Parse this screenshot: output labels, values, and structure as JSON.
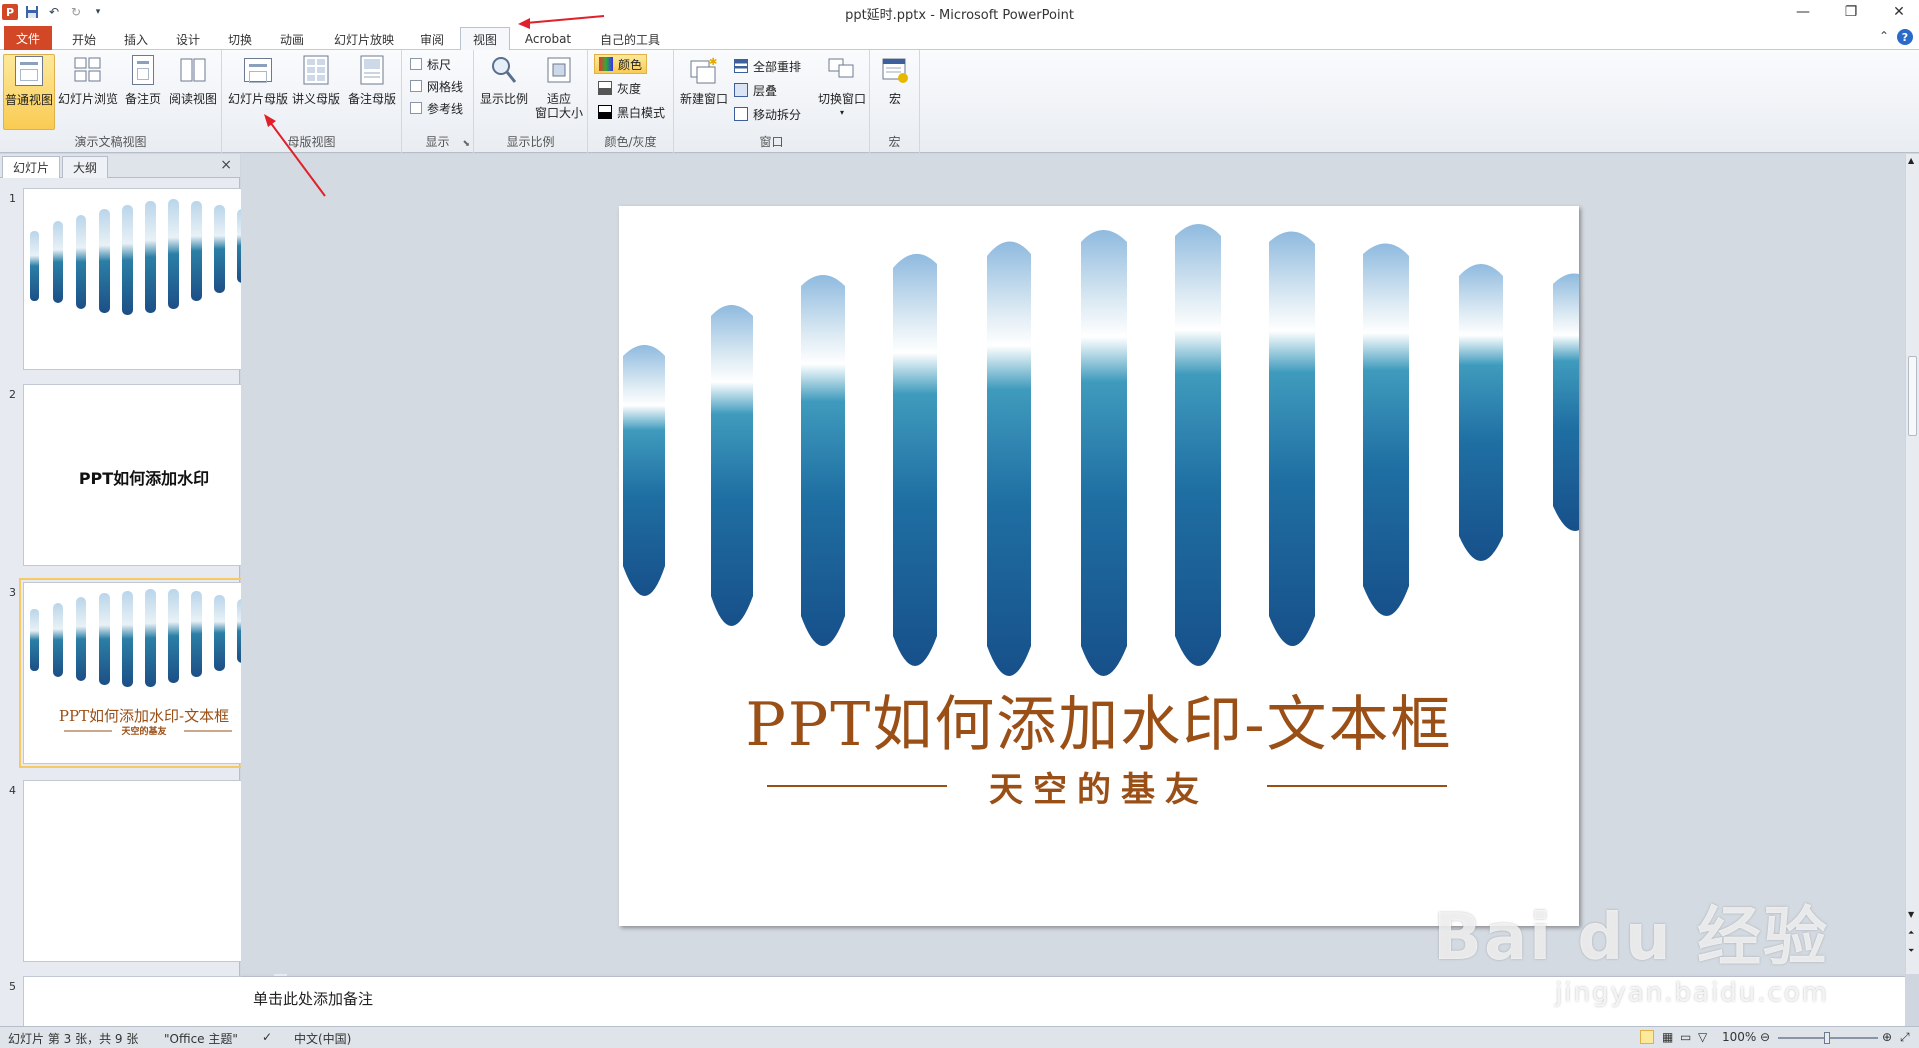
{
  "window": {
    "title": "ppt延时.pptx - Microsoft PowerPoint",
    "help": "?"
  },
  "tabs": [
    "文件",
    "开始",
    "插入",
    "设计",
    "切换",
    "动画",
    "幻灯片放映",
    "审阅",
    "视图",
    "Acrobat",
    "自己的工具"
  ],
  "ribbon": {
    "groups": {
      "presentation_views": {
        "label": "演示文稿视图",
        "buttons": [
          "普通视图",
          "幻灯片浏览",
          "备注页",
          "阅读视图"
        ]
      },
      "master_views": {
        "label": "母版视图",
        "buttons": [
          "幻灯片母版",
          "讲义母版",
          "备注母版"
        ]
      },
      "show": {
        "label": "显示",
        "checks": [
          "标尺",
          "网格线",
          "参考线"
        ]
      },
      "zoom": {
        "label": "显示比例",
        "zoom_label": "显示比例",
        "fit_label_1": "适应",
        "fit_label_2": "窗口大小"
      },
      "color": {
        "label": "颜色/灰度",
        "items": [
          "颜色",
          "灰度",
          "黑白模式"
        ]
      },
      "window": {
        "label": "窗口",
        "new_window": "新建窗口",
        "items": [
          "全部重排",
          "层叠",
          "移动拆分"
        ],
        "switch_window": "切换窗口"
      },
      "macros": {
        "label": "宏",
        "button": "宏"
      }
    }
  },
  "left_panel": {
    "tabs": [
      "幻灯片",
      "大纲"
    ],
    "close": "×",
    "thumbnails": [
      {
        "num": "1",
        "text": ""
      },
      {
        "num": "2",
        "text": "PPT如何添加水印"
      },
      {
        "num": "3",
        "title": "PPT如何添加水印-文本框",
        "subtitle": "天空的基友"
      },
      {
        "num": "4",
        "text": ""
      },
      {
        "num": "5",
        "text": ""
      }
    ]
  },
  "slide": {
    "title": "PPT如何添加水印-文本框",
    "subtitle": "天空的基友"
  },
  "notes": {
    "placeholder": "单击此处添加备注"
  },
  "status": {
    "slide_info": "幻灯片 第 3 张，共 9 张",
    "theme": "\"Office 主题\"",
    "language": "中文(中国)",
    "zoom": "100%"
  },
  "watermark": {
    "brand": "Bai du 经验",
    "url": "jingyan.baidu.com"
  },
  "colors": {
    "file_tab": "#d24726",
    "accent_text": "#9a4f16",
    "annotation_arrow": "#e0202a"
  }
}
